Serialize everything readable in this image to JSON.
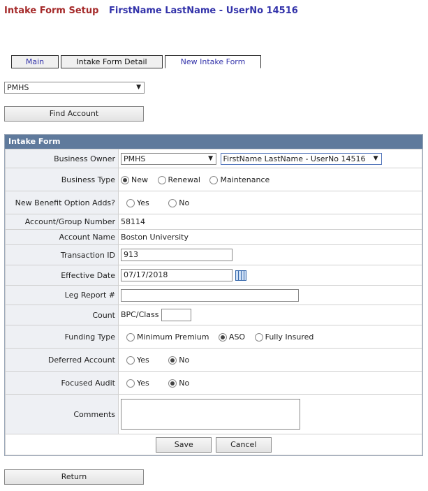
{
  "header": {
    "title": "Intake Form Setup",
    "user": "FirstName LastName - UserNo 14516"
  },
  "tabs": [
    {
      "label": "Main"
    },
    {
      "label": "Intake Form Detail"
    },
    {
      "label": "New Intake Form"
    }
  ],
  "top_select": {
    "value": "PMHS"
  },
  "find_button": "Find Account",
  "panel_title": "Intake Form",
  "fields": {
    "business_owner": {
      "label": "Business Owner",
      "select1": "PMHS",
      "select2": "FirstName LastName - UserNo 14516"
    },
    "business_type": {
      "label": "Business Type",
      "options": [
        "New",
        "Renewal",
        "Maintenance"
      ],
      "selected": "New"
    },
    "benefit_adds": {
      "label": "New Benefit Option Adds?",
      "options": [
        "Yes",
        "No"
      ],
      "selected": ""
    },
    "account_number": {
      "label": "Account/Group Number",
      "value": "58114"
    },
    "account_name": {
      "label": "Account Name",
      "value": "Boston University"
    },
    "transaction_id": {
      "label": "Transaction ID",
      "value": "913"
    },
    "effective_date": {
      "label": "Effective Date",
      "value": "07/17/2018"
    },
    "leg_report": {
      "label": "Leg Report #",
      "value": ""
    },
    "count": {
      "label": "Count",
      "sub_label": "BPC/Class",
      "value": ""
    },
    "funding_type": {
      "label": "Funding Type",
      "options": [
        "Minimum Premium",
        "ASO",
        "Fully Insured"
      ],
      "selected": "ASO"
    },
    "deferred_account": {
      "label": "Deferred Account",
      "options": [
        "Yes",
        "No"
      ],
      "selected": "No"
    },
    "focused_audit": {
      "label": "Focused Audit",
      "options": [
        "Yes",
        "No"
      ],
      "selected": "No"
    },
    "comments": {
      "label": "Comments",
      "value": ""
    }
  },
  "buttons": {
    "save": "Save",
    "cancel": "Cancel",
    "return": "Return"
  }
}
